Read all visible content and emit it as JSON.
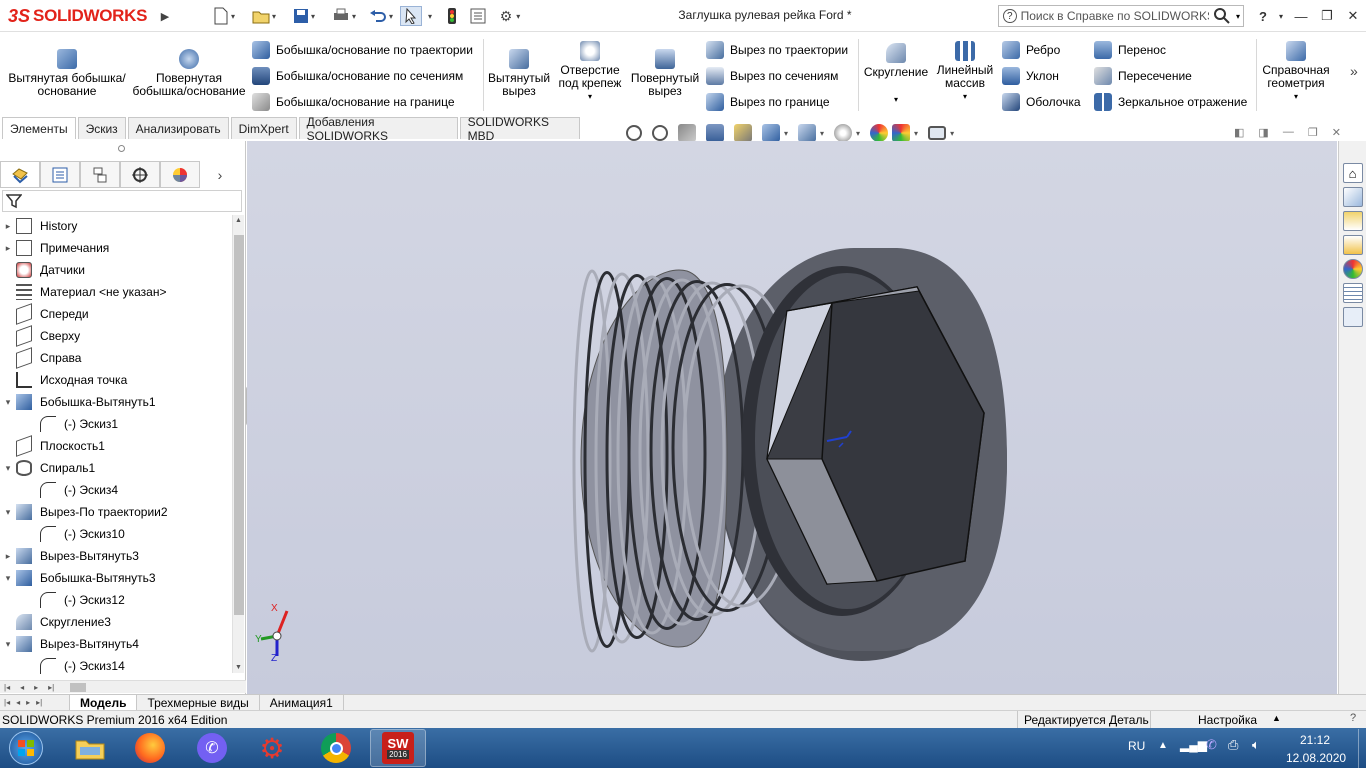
{
  "titlebar": {
    "brand": "SOLIDWORKS",
    "document_title": "Заглушка рулевая рейка Ford *",
    "help_search_placeholder": "Поиск в Справке по SOLIDWORKS",
    "help_label": "?"
  },
  "ribbon": {
    "extruded_boss": "Вытянутая бобышка/основание",
    "revolved_boss": "Повернутая бобышка/основание",
    "swept_boss": "Бобышка/основание по траектории",
    "lofted_boss": "Бобышка/основание по сечениям",
    "boundary_boss": "Бобышка/основание на границе",
    "extruded_cut": "Вытянутый вырез",
    "hole_wizard": "Отверстие под крепеж",
    "revolved_cut": "Повернутый вырез",
    "swept_cut": "Вырез по траектории",
    "lofted_cut": "Вырез по сечениям",
    "boundary_cut": "Вырез по границе",
    "fillet": "Скругление",
    "linear_pattern": "Линейный массив",
    "rib": "Ребро",
    "draft": "Уклон",
    "shell": "Оболочка",
    "wrap": "Перенос",
    "intersect": "Пересечение",
    "mirror": "Зеркальное отражение",
    "reference_geometry": "Справочная геометрия"
  },
  "tabs": [
    "Элементы",
    "Эскиз",
    "Анализировать",
    "DimXpert",
    "Добавления SOLIDWORKS",
    "SOLIDWORKS MBD"
  ],
  "tree": [
    {
      "label": "History",
      "expand": "▸",
      "icon": "history-icon"
    },
    {
      "label": "Примечания",
      "expand": "▸",
      "icon": "annotations-icon"
    },
    {
      "label": "Датчики",
      "expand": "",
      "icon": "sensor-icon"
    },
    {
      "label": "Материал <не указан>",
      "expand": "",
      "icon": "material-icon"
    },
    {
      "label": "Спереди",
      "expand": "",
      "icon": "plane-icon"
    },
    {
      "label": "Сверху",
      "expand": "",
      "icon": "plane-icon"
    },
    {
      "label": "Справа",
      "expand": "",
      "icon": "plane-icon"
    },
    {
      "label": "Исходная точка",
      "expand": "",
      "icon": "origin-icon"
    },
    {
      "label": "Бобышка-Вытянуть1",
      "expand": "▾",
      "icon": "boss-extrude-icon"
    },
    {
      "label": "(-) Эскиз1",
      "expand": "",
      "icon": "sketch-icon",
      "child": true
    },
    {
      "label": "Плоскость1",
      "expand": "",
      "icon": "plane-icon"
    },
    {
      "label": "Спираль1",
      "expand": "▾",
      "icon": "helix-icon"
    },
    {
      "label": "(-) Эскиз4",
      "expand": "",
      "icon": "sketch-icon",
      "child": true
    },
    {
      "label": "Вырез-По траектории2",
      "expand": "▾",
      "icon": "swept-cut-icon"
    },
    {
      "label": "(-) Эскиз10",
      "expand": "",
      "icon": "sketch-icon",
      "child": true
    },
    {
      "label": "Вырез-Вытянуть3",
      "expand": "▸",
      "icon": "cut-extrude-icon"
    },
    {
      "label": "Бобышка-Вытянуть3",
      "expand": "▾",
      "icon": "boss-extrude-icon"
    },
    {
      "label": "(-) Эскиз12",
      "expand": "",
      "icon": "sketch-icon",
      "child": true
    },
    {
      "label": "Скругление3",
      "expand": "",
      "icon": "fillet-icon"
    },
    {
      "label": "Вырез-Вытянуть4",
      "expand": "▾",
      "icon": "cut-extrude-icon"
    },
    {
      "label": "(-) Эскиз14",
      "expand": "",
      "icon": "sketch-icon",
      "child": true
    }
  ],
  "triad": {
    "x": "X",
    "y": "Y",
    "z": "Z"
  },
  "bottom_tabs": [
    "Модель",
    "Трехмерные виды",
    "Анимация1"
  ],
  "status": {
    "edition": "SOLIDWORKS Premium 2016 x64 Edition",
    "editing": "Редактируется Деталь",
    "custom": "Настройка"
  },
  "taskbar": {
    "lang": "RU",
    "time": "21:12",
    "date": "12.08.2020",
    "sw_badge": "2016"
  },
  "colors": {
    "brand_red": "#e2231a",
    "viewport_bg": "#cdd0df",
    "part_gray": "#7a7d87"
  }
}
